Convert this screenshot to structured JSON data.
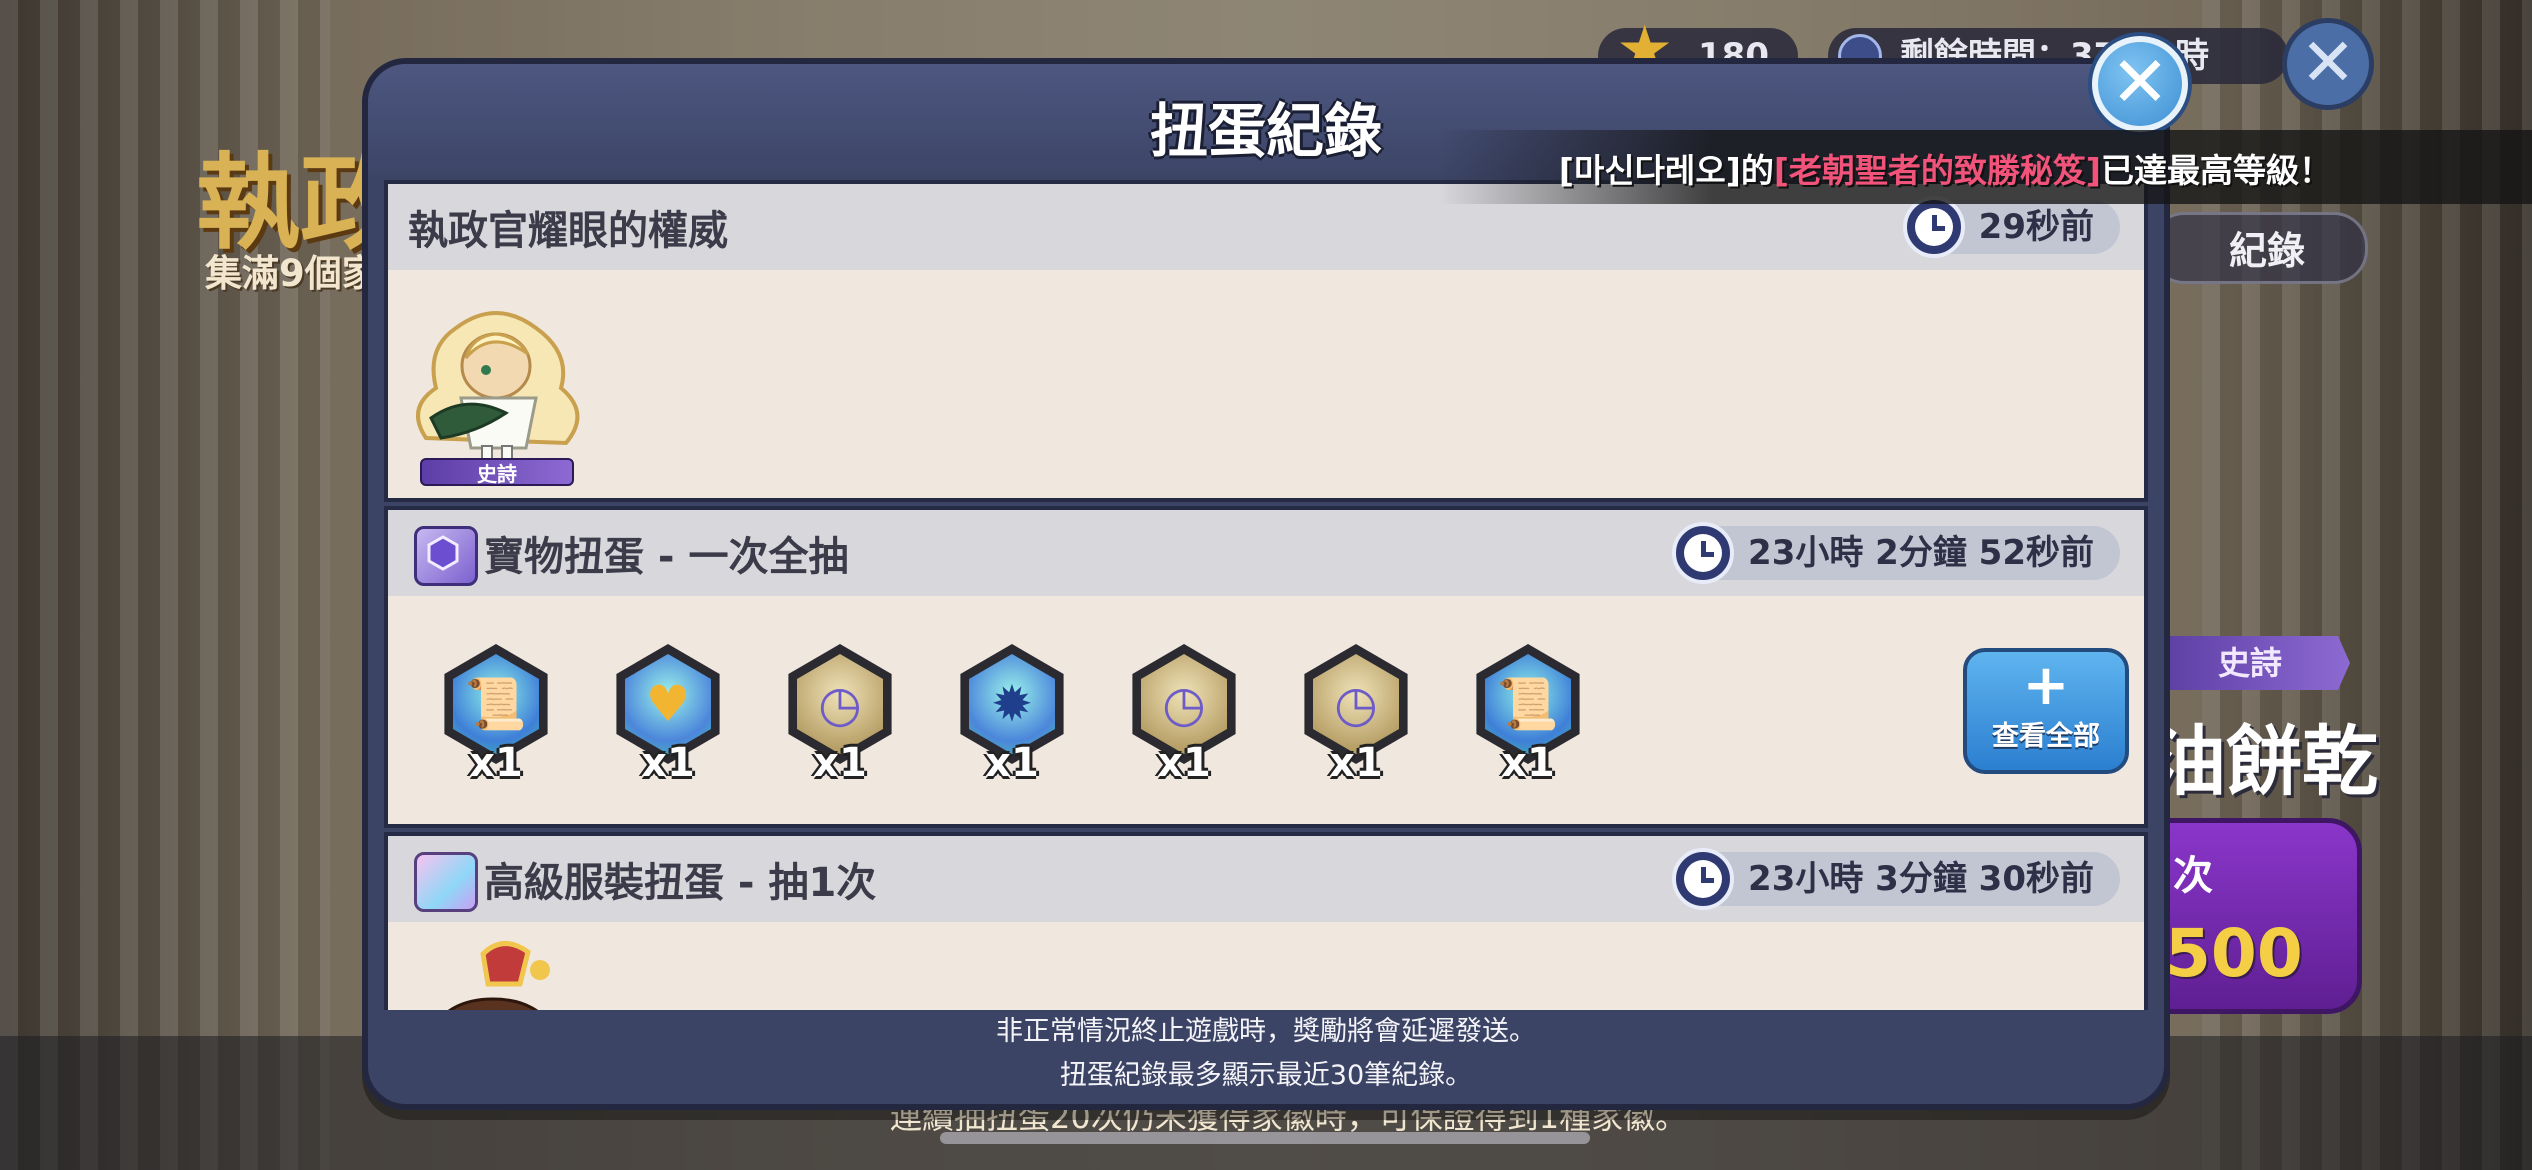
{
  "background": {
    "title": "執政",
    "subtitle": "集滿9個家",
    "star_count": "180",
    "remaining_time": "剩餘時間：375小時",
    "record_button": "紀錄",
    "grade_tag": "史詩",
    "cookie_name": "油餅乾",
    "buy_label": "次",
    "buy_price": "500",
    "bottom_text": "連續抽扭蛋20次仍未獲得家徽時，可保證得到1種家徽。"
  },
  "notice": {
    "player": "[마신다레오]",
    "connector": "的",
    "item": "[老朝聖者的致勝秘笈]",
    "suffix": "已達最高等級！"
  },
  "modal": {
    "title": "扭蛋紀錄",
    "records": [
      {
        "title": "執政官耀眼的權威",
        "time": "29秒前",
        "grade_tag": "史詩"
      },
      {
        "title": "寶物扭蛋 - 一次全抽",
        "time": "23小時 2分鐘 52秒前",
        "items": [
          {
            "icon": "pink-scroll-icon",
            "qty": "x1"
          },
          {
            "icon": "candy-heart-icon",
            "qty": "x1"
          },
          {
            "icon": "stopwatch-icon",
            "qty": "x1"
          },
          {
            "icon": "blue-beast-icon",
            "qty": "x1"
          },
          {
            "icon": "stopwatch-icon",
            "qty": "x1"
          },
          {
            "icon": "stopwatch-icon",
            "qty": "x1"
          },
          {
            "icon": "pink-scroll-icon",
            "qty": "x1"
          }
        ],
        "view_all_label": "查看全部"
      },
      {
        "title": "高級服裝扭蛋 - 抽1次",
        "time": "23小時 3分鐘 30秒前"
      }
    ],
    "footer": [
      "非正常情況終止遊戲時，獎勵將會延遲發送。",
      "扭蛋紀錄最多顯示最近30筆紀錄。"
    ]
  }
}
